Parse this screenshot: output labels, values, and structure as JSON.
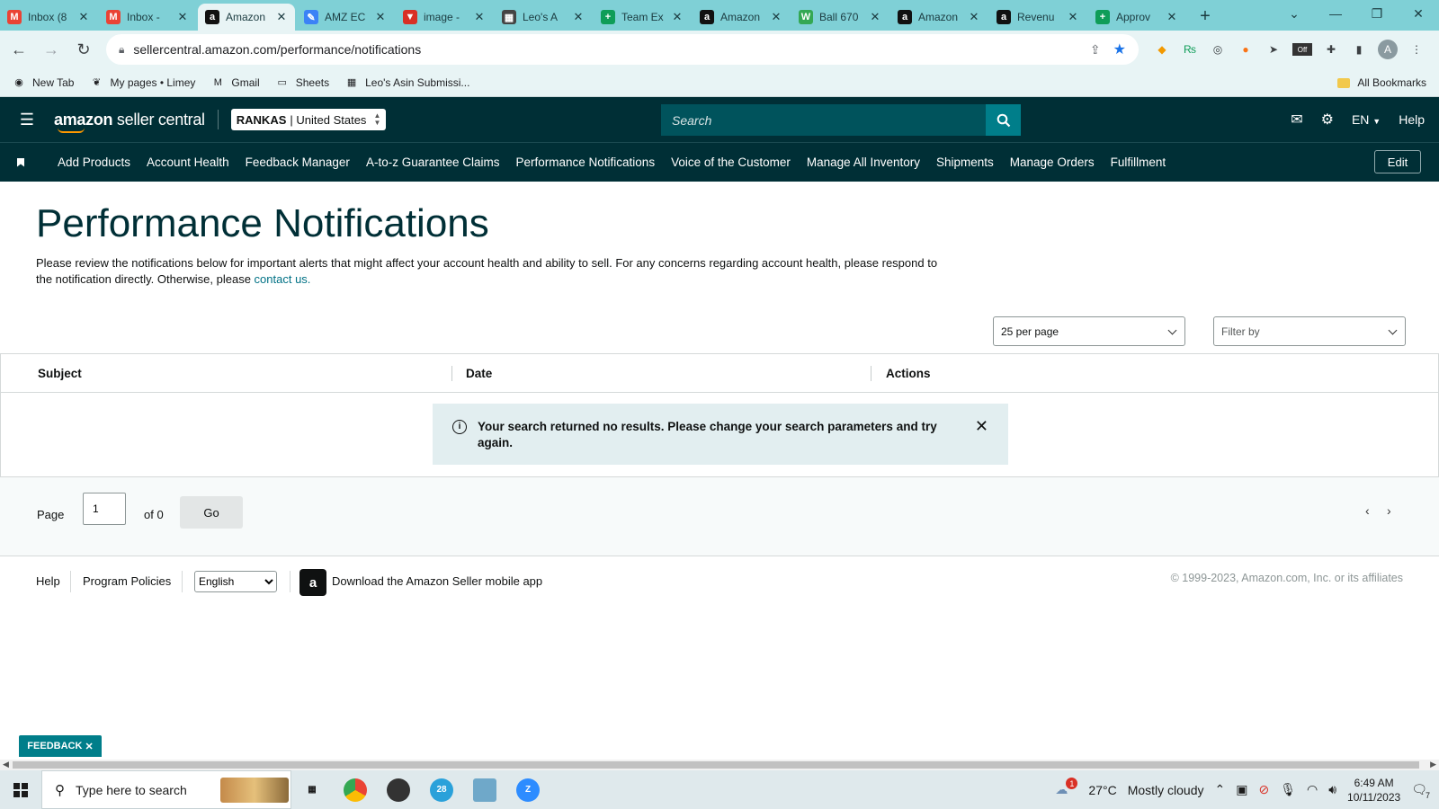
{
  "browser": {
    "tabs": [
      {
        "label": "Inbox (8",
        "icon": "gmail-icon",
        "color": "#ea4335",
        "glyph": "M"
      },
      {
        "label": "Inbox - ",
        "icon": "gmail-icon",
        "color": "#ea4335",
        "glyph": "M"
      },
      {
        "label": "Amazon",
        "icon": "amazon-icon",
        "color": "#111111",
        "glyph": "a"
      },
      {
        "label": "AMZ EC",
        "icon": "pencil-icon",
        "color": "#3b82f6",
        "glyph": "✎"
      },
      {
        "label": "image - ",
        "icon": "keepa-icon",
        "color": "#d93025",
        "glyph": "▼"
      },
      {
        "label": "Leo's A",
        "icon": "ms-icon",
        "color": "#444444",
        "glyph": "▦"
      },
      {
        "label": "Team Ex",
        "icon": "sheets-icon",
        "color": "#0f9d58",
        "glyph": "+"
      },
      {
        "label": "Amazon",
        "icon": "amazon-icon",
        "color": "#111111",
        "glyph": "a"
      },
      {
        "label": "Ball 670",
        "icon": "w-icon",
        "color": "#34a853",
        "glyph": "W"
      },
      {
        "label": "Amazon",
        "icon": "amazon-icon",
        "color": "#111111",
        "glyph": "a"
      },
      {
        "label": "Revenu",
        "icon": "amazon-icon",
        "color": "#111111",
        "glyph": "a"
      },
      {
        "label": "Approv",
        "icon": "sheets-icon",
        "color": "#0f9d58",
        "glyph": "+"
      }
    ],
    "url": "sellercentral.amazon.com/performance/notifications",
    "bookmarks": [
      {
        "label": "New Tab",
        "glyph": "◉"
      },
      {
        "label": "My pages • Limey",
        "glyph": "❦"
      },
      {
        "label": "Gmail",
        "glyph": "M"
      },
      {
        "label": "Sheets",
        "glyph": "▭"
      },
      {
        "label": "Leo's Asin Submissi...",
        "glyph": "▦"
      }
    ],
    "all_bookmarks": "All Bookmarks",
    "profile_initial": "A",
    "ext_badge": "Off"
  },
  "header": {
    "logo_bold": "amazon",
    "logo_light": " seller central",
    "account_name": "RANKAS",
    "account_region": "| United States",
    "search_placeholder": "Search",
    "language": "EN",
    "help": "Help"
  },
  "nav": {
    "items": [
      "Add Products",
      "Account Health",
      "Feedback Manager",
      "A-to-z Guarantee Claims",
      "Performance Notifications",
      "Voice of the Customer",
      "Manage All Inventory",
      "Shipments",
      "Manage Orders",
      "Fulfillment"
    ],
    "edit": "Edit"
  },
  "page": {
    "title": "Performance Notifications",
    "intro": "Please review the notifications below for important alerts that might affect your account health and ability to sell. For any concerns regarding account health, please respond to the notification directly. Otherwise, please ",
    "contact_link": "contact us."
  },
  "controls": {
    "per_page": "25 per page",
    "filter_by": "Filter by"
  },
  "table": {
    "columns": [
      "Subject",
      "Date",
      "Actions"
    ],
    "empty_message": "Your search returned no results. Please change your search parameters and try again."
  },
  "pager": {
    "page_label": "Page",
    "page_value": "1",
    "of_label": "of 0",
    "go_label": "Go"
  },
  "footer": {
    "help": "Help",
    "program_policies": "Program Policies",
    "language_selected": "English",
    "download_app": "Download the Amazon Seller mobile app",
    "copyright": "© 1999-2023, Amazon.com, Inc. or its affiliates"
  },
  "feedback": {
    "label": "FEEDBACK"
  },
  "taskbar": {
    "search_placeholder": "Type here to search",
    "weather_temp": "27°C",
    "weather_desc": "Mostly cloudy",
    "weather_badge": "1",
    "time": "6:49 AM",
    "date": "10/11/2023",
    "notif_count": "7",
    "app_badge": "28"
  },
  "colors": {
    "header_bg": "#002f36",
    "accent": "#007e8a",
    "link": "#007185",
    "chrome_frame": "#7fd0d6"
  }
}
